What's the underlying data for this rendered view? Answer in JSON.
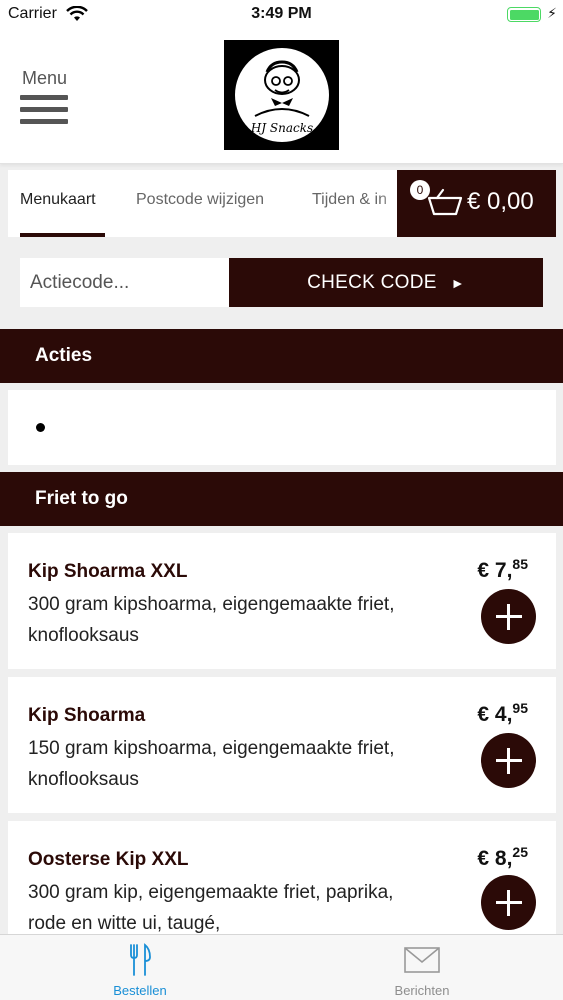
{
  "status_bar": {
    "carrier": "Carrier",
    "time": "3:49 PM"
  },
  "header": {
    "menu_label": "Menu",
    "logo_text": "HJ Snacks"
  },
  "tabs": [
    {
      "label": "Menukaart",
      "active": true
    },
    {
      "label": "Postcode wijzigen",
      "active": false
    },
    {
      "label": "Tijden & in",
      "active": false
    }
  ],
  "cart": {
    "count": "0",
    "total": "€ 0,00"
  },
  "promo": {
    "placeholder": "Actiecode...",
    "button_label": "CHECK CODE",
    "button_arrow": "►"
  },
  "sections": [
    {
      "title": "Acties"
    },
    {
      "title": "Friet to go"
    }
  ],
  "products": [
    {
      "name": "Kip Shoarma XXL",
      "description": "300 gram kipshoarma, eigengemaakte friet, knoflooksaus",
      "price_main": "€ 7,",
      "price_cents": "85"
    },
    {
      "name": "Kip Shoarma",
      "description": "150 gram kipshoarma, eigengemaakte friet, knoflooksaus",
      "price_main": "€ 4,",
      "price_cents": "95"
    },
    {
      "name": "Oosterse Kip XXL",
      "description": "300 gram kip, eigengemaakte friet, paprika, rode en witte ui, taugé,",
      "price_main": "€ 8,",
      "price_cents": "25"
    }
  ],
  "bottom_nav": [
    {
      "label": "Bestellen",
      "icon": "cutlery-icon",
      "active": true
    },
    {
      "label": "Berichten",
      "icon": "envelope-icon",
      "active": false
    }
  ],
  "colors": {
    "brand": "#2b0a07",
    "active_tab": "#1a8fd6",
    "battery": "#4cd964"
  }
}
